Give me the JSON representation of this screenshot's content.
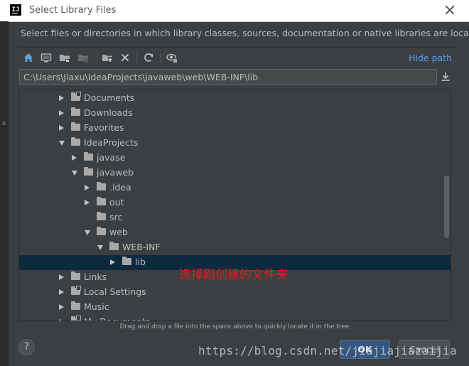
{
  "window": {
    "app_icon_text": "IJ",
    "title": "Select Library Files"
  },
  "left_strip": {
    "text": "s"
  },
  "description": "Select files or directories in which library classes, sources, documentation or native libraries are located",
  "toolbar": {
    "icons": [
      "home-icon",
      "desktop-icon",
      "project-folder-icon",
      "module-folder-icon",
      "new-folder-icon",
      "delete-icon",
      "refresh-icon",
      "show-hidden-icon"
    ],
    "hide_path_label": "Hide path"
  },
  "path": {
    "value": "C:\\Users\\Jiaxu\\IdeaProjects\\javaweb\\web\\WEB-INF\\lib"
  },
  "tree": {
    "rows": [
      {
        "label": "Documents",
        "level": 0,
        "expanded": false,
        "has_arrow": true,
        "special": true
      },
      {
        "label": "Downloads",
        "level": 0,
        "expanded": false,
        "has_arrow": true,
        "special": false
      },
      {
        "label": "Favorites",
        "level": 0,
        "expanded": false,
        "has_arrow": true,
        "special": false
      },
      {
        "label": "IdeaProjects",
        "level": 0,
        "expanded": true,
        "has_arrow": true,
        "special": false
      },
      {
        "label": "javase",
        "level": 1,
        "expanded": false,
        "has_arrow": true,
        "special": false
      },
      {
        "label": "javaweb",
        "level": 1,
        "expanded": true,
        "has_arrow": true,
        "special": false
      },
      {
        "label": ".idea",
        "level": 2,
        "expanded": false,
        "has_arrow": true,
        "special": false
      },
      {
        "label": "out",
        "level": 2,
        "expanded": false,
        "has_arrow": true,
        "special": false
      },
      {
        "label": "src",
        "level": 2,
        "expanded": false,
        "has_arrow": false,
        "special": false
      },
      {
        "label": "web",
        "level": 2,
        "expanded": true,
        "has_arrow": true,
        "special": false
      },
      {
        "label": "WEB-INF",
        "level": 3,
        "expanded": true,
        "has_arrow": true,
        "special": false
      },
      {
        "label": "lib",
        "level": 4,
        "expanded": false,
        "has_arrow": true,
        "special": false,
        "selected": true
      },
      {
        "label": "Links",
        "level": 0,
        "expanded": false,
        "has_arrow": true,
        "special": false
      },
      {
        "label": "Local Settings",
        "level": 0,
        "expanded": false,
        "has_arrow": true,
        "special": true
      },
      {
        "label": "Music",
        "level": 0,
        "expanded": false,
        "has_arrow": true,
        "special": false
      },
      {
        "label": "My Documents",
        "level": 0,
        "expanded": false,
        "has_arrow": true,
        "special": true
      }
    ]
  },
  "annotation": "选择刚创建的文件夹",
  "drag_hint": "Drag and drop a file into the space above to quickly locate it in the tree",
  "buttons": {
    "help": "?",
    "ok": "OK",
    "cancel": "Cancel"
  },
  "watermark": "https://blog.csdn.net/jiajiajiazaijia",
  "colors": {
    "background": "#3c3f41",
    "selection": "#0d293e",
    "link": "#589df6",
    "ok_button": "#365880",
    "annotation": "#e0201a"
  }
}
